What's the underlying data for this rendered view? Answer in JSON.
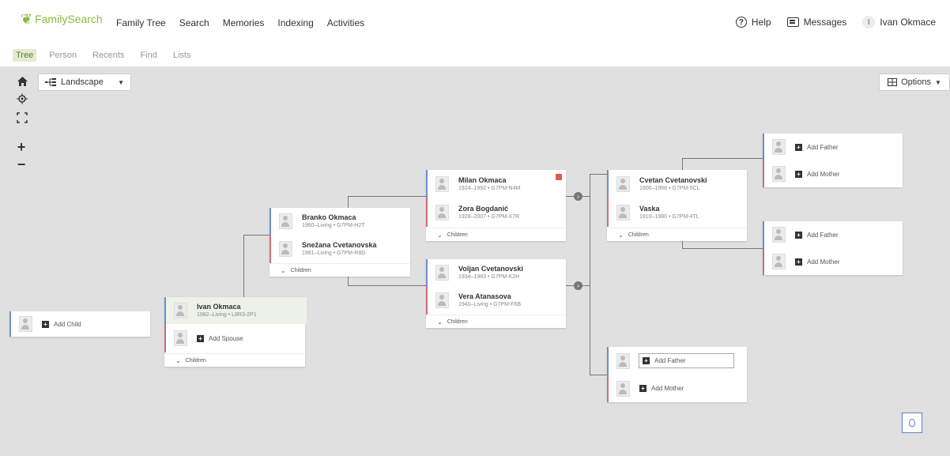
{
  "topbar": {
    "logo": "FamilySearch",
    "nav": [
      "Family Tree",
      "Search",
      "Memories",
      "Indexing",
      "Activities"
    ],
    "help": "Help",
    "messages": "Messages",
    "user_initial": "I",
    "user_name": "Ivan Okmace"
  },
  "subnav": {
    "tabs": [
      "Tree",
      "Person",
      "Recents",
      "Find",
      "Lists"
    ],
    "active": "Tree"
  },
  "controls": {
    "view": "Landscape",
    "view_icon": "landscape-tree-icon",
    "options": "Options",
    "home_icon": "home-icon",
    "locate_icon": "crosshair-icon",
    "fullscreen_icon": "expand-icon",
    "zoom_in": "+",
    "zoom_out": "−"
  },
  "colors": {
    "male_bar": "#6b8fd6",
    "female_bar": "#d46b7d",
    "brand": "#8ab83f",
    "canvas_bg": "#e0e0e0"
  },
  "labels": {
    "add_child": "Add Child",
    "add_spouse": "Add Spouse",
    "add_father": "Add Father",
    "add_mother": "Add Mother",
    "children": "Children"
  },
  "people": {
    "ivan": {
      "name": "Ivan Okmaca",
      "dates": "1982–Living • L8R3-2P1"
    },
    "branko": {
      "name": "Branko Okmaca",
      "dates": "1960–Living • G7PM-H2T"
    },
    "snezana": {
      "name": "Snežana Cvetanovska",
      "dates": "1961–Living • G7PM-R8D"
    },
    "milan": {
      "name": "Milan Okmaca",
      "dates": "1924–1992 • G7PM-N4M"
    },
    "zora_b": {
      "name": "Zora Bogdanić",
      "dates": "1928–2007 • G7PM-X7R"
    },
    "voljan": {
      "name": "Voljan Cvetanovski",
      "dates": "1934–1983 • G7PM-K2H"
    },
    "vera": {
      "name": "Vera Atanasova",
      "dates": "1940–Living • G7PM-F6B"
    },
    "cvetan": {
      "name": "Cvetan Cvetanovski",
      "dates": "1900–1968 • G7PM-5CL"
    },
    "vaska": {
      "name": "Vaska",
      "dates": "1910–1980 • G7PM-4TL"
    }
  }
}
